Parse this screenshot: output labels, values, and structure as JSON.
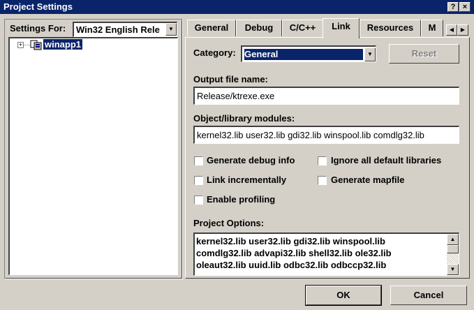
{
  "window": {
    "title": "Project Settings",
    "help_label": "?",
    "close_label": "×"
  },
  "left": {
    "settings_for_label": "Settings For:",
    "settings_for_value": "Win32 English Rele",
    "tree": [
      {
        "expander": "+",
        "label": "winapp1",
        "selected": true
      }
    ]
  },
  "tabs": [
    {
      "label": "General",
      "active": false
    },
    {
      "label": "Debug",
      "active": false
    },
    {
      "label": "C/C++",
      "active": false
    },
    {
      "label": "Link",
      "active": true
    },
    {
      "label": "Resources",
      "active": false
    },
    {
      "label": "M",
      "active": false
    }
  ],
  "link": {
    "category_label": "Category:",
    "category_value": "General",
    "reset_label": "Reset",
    "output_label": "Output file name:",
    "output_value": "Release/ktrexe.exe",
    "modules_label": "Object/library modules:",
    "modules_value": "kernel32.lib user32.lib gdi32.lib winspool.lib comdlg32.lib",
    "checkboxes": [
      {
        "label": "Generate debug info",
        "checked": false
      },
      {
        "label": "Ignore all default libraries",
        "checked": false
      },
      {
        "label": "Link incrementally",
        "checked": false
      },
      {
        "label": "Generate mapfile",
        "checked": false
      },
      {
        "label": "Enable profiling",
        "checked": false
      }
    ],
    "project_options_label": "Project Options:",
    "project_options_lines": [
      "kernel32.lib user32.lib gdi32.lib winspool.lib",
      "comdlg32.lib advapi32.lib shell32.lib ole32.lib",
      "oleaut32.lib uuid.lib odbc32.lib odbccp32.lib"
    ]
  },
  "buttons": {
    "ok": "OK",
    "cancel": "Cancel"
  }
}
